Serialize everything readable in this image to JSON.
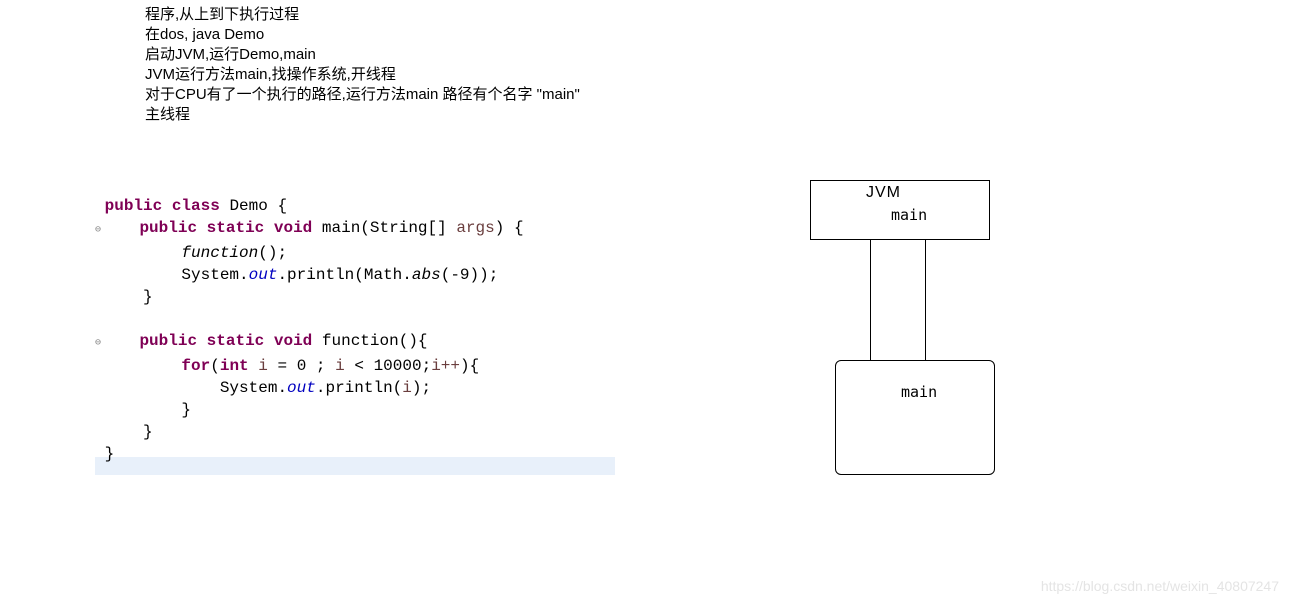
{
  "description": {
    "line1": "程序,从上到下执行过程",
    "line2": "在dos, java Demo",
    "line3": "启动JVM,运行Demo,main",
    "line4": "JVM运行方法main,找操作系统,开线程",
    "line5": "对于CPU有了一个执行的路径,运行方法main 路径有个名字 \"main\"",
    "line6": "主线程"
  },
  "code": {
    "kw_public": "public",
    "kw_class": "class",
    "kw_static": "static",
    "kw_void": "void",
    "kw_for": "for",
    "kw_int": "int",
    "cls_demo": "Demo",
    "fn_main": "main",
    "fn_function": "function",
    "param_args": "args",
    "type_string_arr": "String[]",
    "call_function": "function",
    "sys": "System.",
    "out": "out",
    "println": ".println",
    "math": "Math.",
    "abs": "abs",
    "neg9": "-9",
    "var_i": "i",
    "eq0": "= 0",
    "lt": "<",
    "limit": "10000",
    "inc": "i++",
    "println_i": "i",
    "brace_open": "{",
    "brace_close": "}",
    "paren_open": "(",
    "paren_close": ")",
    "semi": ";",
    "marker": "⊖"
  },
  "diagram": {
    "jvm": "JVM",
    "main1": "main",
    "main2": "main"
  },
  "watermark": "https://blog.csdn.net/weixin_40807247"
}
